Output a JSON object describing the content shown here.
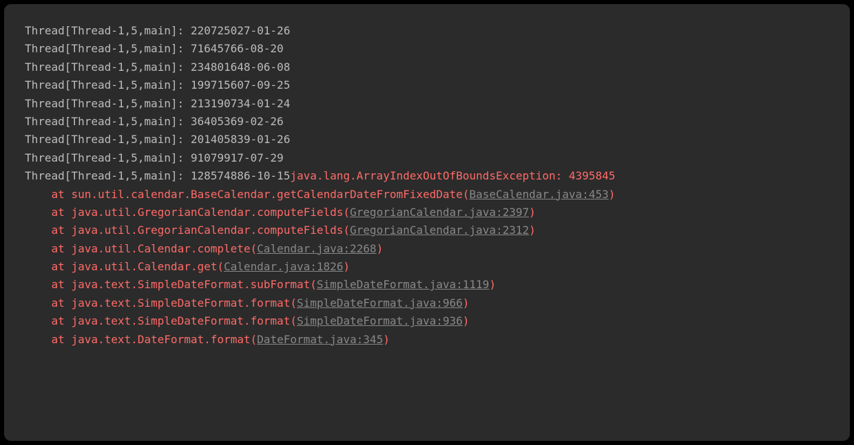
{
  "thread_prefix": "Thread[Thread-1,5,main]: ",
  "normal_logs": [
    "220725027-01-26",
    "71645766-08-20",
    "234801648-06-08",
    "199715607-09-25",
    "213190734-01-24",
    "36405369-02-26",
    "201405839-01-26",
    "91079917-07-29"
  ],
  "final_log_value": "128574886-10-15",
  "exception_text": "java.lang.ArrayIndexOutOfBoundsException: 4395845",
  "stack_indent": "    ",
  "at_text": "at ",
  "stack_frames": [
    {
      "method": "sun.util.calendar.BaseCalendar.getCalendarDateFromFixedDate",
      "source": "BaseCalendar.java:453"
    },
    {
      "method": "java.util.GregorianCalendar.computeFields",
      "source": "GregorianCalendar.java:2397"
    },
    {
      "method": "java.util.GregorianCalendar.computeFields",
      "source": "GregorianCalendar.java:2312"
    },
    {
      "method": "java.util.Calendar.complete",
      "source": "Calendar.java:2268"
    },
    {
      "method": "java.util.Calendar.get",
      "source": "Calendar.java:1826"
    },
    {
      "method": "java.text.SimpleDateFormat.subFormat",
      "source": "SimpleDateFormat.java:1119"
    },
    {
      "method": "java.text.SimpleDateFormat.format",
      "source": "SimpleDateFormat.java:966"
    },
    {
      "method": "java.text.SimpleDateFormat.format",
      "source": "SimpleDateFormat.java:936"
    },
    {
      "method": "java.text.DateFormat.format",
      "source": "DateFormat.java:345"
    }
  ]
}
